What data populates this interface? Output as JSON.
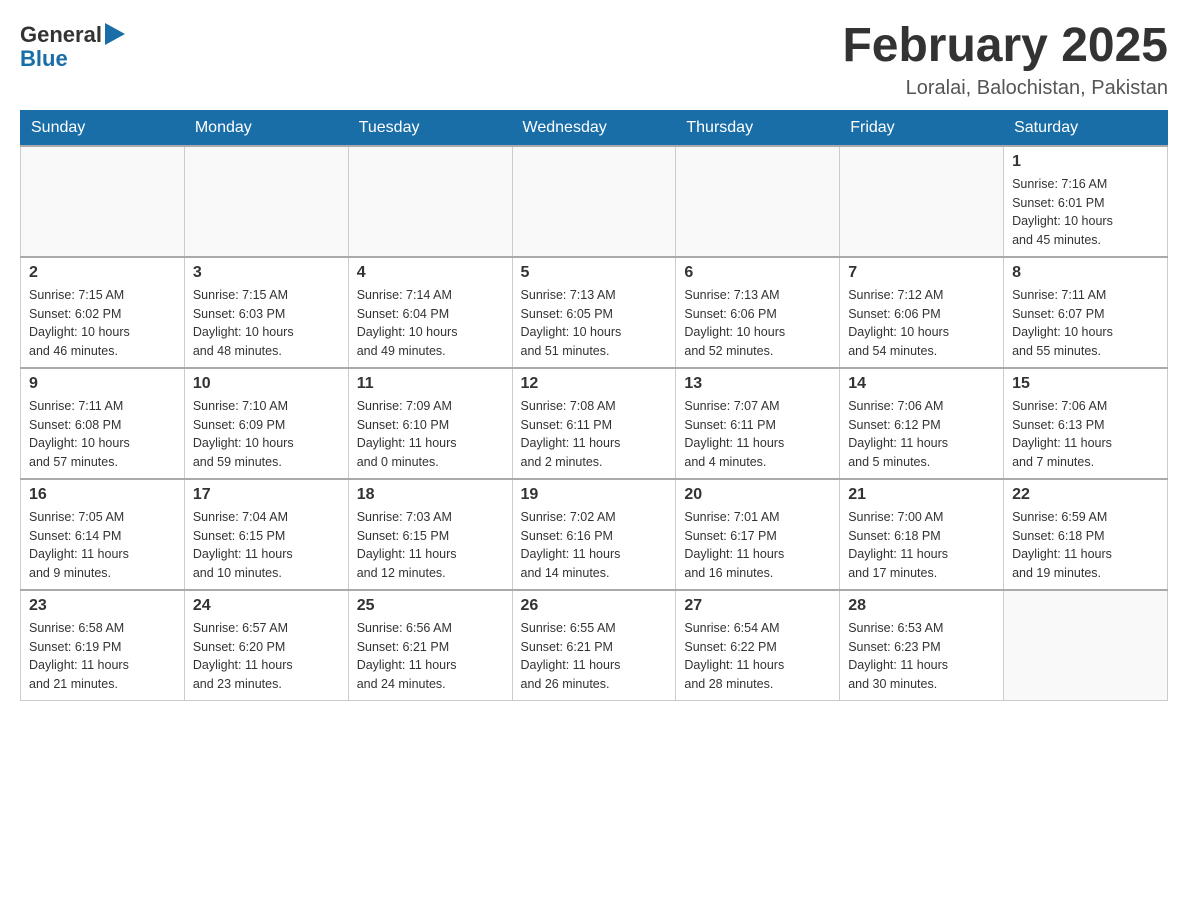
{
  "logo": {
    "general": "General",
    "blue": "Blue",
    "arrow": "▶"
  },
  "header": {
    "title": "February 2025",
    "location": "Loralai, Balochistan, Pakistan"
  },
  "weekdays": [
    "Sunday",
    "Monday",
    "Tuesday",
    "Wednesday",
    "Thursday",
    "Friday",
    "Saturday"
  ],
  "weeks": [
    [
      {
        "day": "",
        "info": ""
      },
      {
        "day": "",
        "info": ""
      },
      {
        "day": "",
        "info": ""
      },
      {
        "day": "",
        "info": ""
      },
      {
        "day": "",
        "info": ""
      },
      {
        "day": "",
        "info": ""
      },
      {
        "day": "1",
        "info": "Sunrise: 7:16 AM\nSunset: 6:01 PM\nDaylight: 10 hours\nand 45 minutes."
      }
    ],
    [
      {
        "day": "2",
        "info": "Sunrise: 7:15 AM\nSunset: 6:02 PM\nDaylight: 10 hours\nand 46 minutes."
      },
      {
        "day": "3",
        "info": "Sunrise: 7:15 AM\nSunset: 6:03 PM\nDaylight: 10 hours\nand 48 minutes."
      },
      {
        "day": "4",
        "info": "Sunrise: 7:14 AM\nSunset: 6:04 PM\nDaylight: 10 hours\nand 49 minutes."
      },
      {
        "day": "5",
        "info": "Sunrise: 7:13 AM\nSunset: 6:05 PM\nDaylight: 10 hours\nand 51 minutes."
      },
      {
        "day": "6",
        "info": "Sunrise: 7:13 AM\nSunset: 6:06 PM\nDaylight: 10 hours\nand 52 minutes."
      },
      {
        "day": "7",
        "info": "Sunrise: 7:12 AM\nSunset: 6:06 PM\nDaylight: 10 hours\nand 54 minutes."
      },
      {
        "day": "8",
        "info": "Sunrise: 7:11 AM\nSunset: 6:07 PM\nDaylight: 10 hours\nand 55 minutes."
      }
    ],
    [
      {
        "day": "9",
        "info": "Sunrise: 7:11 AM\nSunset: 6:08 PM\nDaylight: 10 hours\nand 57 minutes."
      },
      {
        "day": "10",
        "info": "Sunrise: 7:10 AM\nSunset: 6:09 PM\nDaylight: 10 hours\nand 59 minutes."
      },
      {
        "day": "11",
        "info": "Sunrise: 7:09 AM\nSunset: 6:10 PM\nDaylight: 11 hours\nand 0 minutes."
      },
      {
        "day": "12",
        "info": "Sunrise: 7:08 AM\nSunset: 6:11 PM\nDaylight: 11 hours\nand 2 minutes."
      },
      {
        "day": "13",
        "info": "Sunrise: 7:07 AM\nSunset: 6:11 PM\nDaylight: 11 hours\nand 4 minutes."
      },
      {
        "day": "14",
        "info": "Sunrise: 7:06 AM\nSunset: 6:12 PM\nDaylight: 11 hours\nand 5 minutes."
      },
      {
        "day": "15",
        "info": "Sunrise: 7:06 AM\nSunset: 6:13 PM\nDaylight: 11 hours\nand 7 minutes."
      }
    ],
    [
      {
        "day": "16",
        "info": "Sunrise: 7:05 AM\nSunset: 6:14 PM\nDaylight: 11 hours\nand 9 minutes."
      },
      {
        "day": "17",
        "info": "Sunrise: 7:04 AM\nSunset: 6:15 PM\nDaylight: 11 hours\nand 10 minutes."
      },
      {
        "day": "18",
        "info": "Sunrise: 7:03 AM\nSunset: 6:15 PM\nDaylight: 11 hours\nand 12 minutes."
      },
      {
        "day": "19",
        "info": "Sunrise: 7:02 AM\nSunset: 6:16 PM\nDaylight: 11 hours\nand 14 minutes."
      },
      {
        "day": "20",
        "info": "Sunrise: 7:01 AM\nSunset: 6:17 PM\nDaylight: 11 hours\nand 16 minutes."
      },
      {
        "day": "21",
        "info": "Sunrise: 7:00 AM\nSunset: 6:18 PM\nDaylight: 11 hours\nand 17 minutes."
      },
      {
        "day": "22",
        "info": "Sunrise: 6:59 AM\nSunset: 6:18 PM\nDaylight: 11 hours\nand 19 minutes."
      }
    ],
    [
      {
        "day": "23",
        "info": "Sunrise: 6:58 AM\nSunset: 6:19 PM\nDaylight: 11 hours\nand 21 minutes."
      },
      {
        "day": "24",
        "info": "Sunrise: 6:57 AM\nSunset: 6:20 PM\nDaylight: 11 hours\nand 23 minutes."
      },
      {
        "day": "25",
        "info": "Sunrise: 6:56 AM\nSunset: 6:21 PM\nDaylight: 11 hours\nand 24 minutes."
      },
      {
        "day": "26",
        "info": "Sunrise: 6:55 AM\nSunset: 6:21 PM\nDaylight: 11 hours\nand 26 minutes."
      },
      {
        "day": "27",
        "info": "Sunrise: 6:54 AM\nSunset: 6:22 PM\nDaylight: 11 hours\nand 28 minutes."
      },
      {
        "day": "28",
        "info": "Sunrise: 6:53 AM\nSunset: 6:23 PM\nDaylight: 11 hours\nand 30 minutes."
      },
      {
        "day": "",
        "info": ""
      }
    ]
  ]
}
